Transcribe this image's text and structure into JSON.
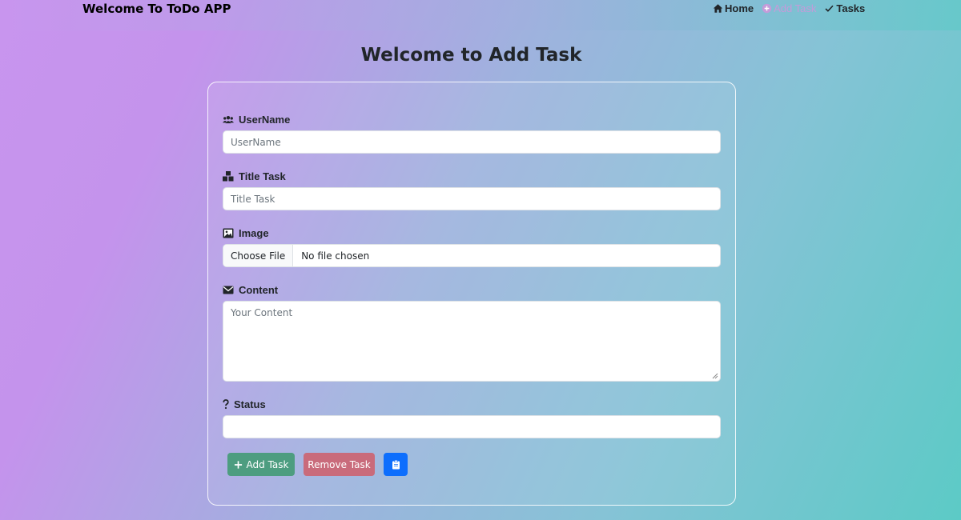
{
  "navbar": {
    "brand": "Welcome To ToDo APP",
    "links": [
      {
        "label": "Home",
        "icon": "home-icon"
      },
      {
        "label": "Add Task",
        "icon": "plus-circle-icon",
        "active": true
      },
      {
        "label": "Tasks",
        "icon": "check-icon"
      }
    ]
  },
  "page": {
    "title": "Welcome to Add Task"
  },
  "form": {
    "username": {
      "label": "UserName",
      "placeholder": "UserName",
      "icon": "users-icon"
    },
    "title_task": {
      "label": "Title Task",
      "placeholder": "Title Task",
      "icon": "cubes-icon"
    },
    "image": {
      "label": "Image",
      "button": "Choose File",
      "file_status": "No file chosen",
      "icon": "image-icon"
    },
    "content": {
      "label": "Content",
      "placeholder": "Your Content",
      "icon": "envelope-icon"
    },
    "status": {
      "label": "Status",
      "value": "",
      "icon": "question-icon"
    },
    "buttons": {
      "add": "Add Task",
      "remove": "Remove Task",
      "clipboard_icon": "clipboard-icon"
    }
  },
  "colors": {
    "add_button": "#4d9d80",
    "remove_button": "#c96b7b",
    "clipboard_button": "#0d6efd",
    "active_nav": "#c49bd9"
  }
}
